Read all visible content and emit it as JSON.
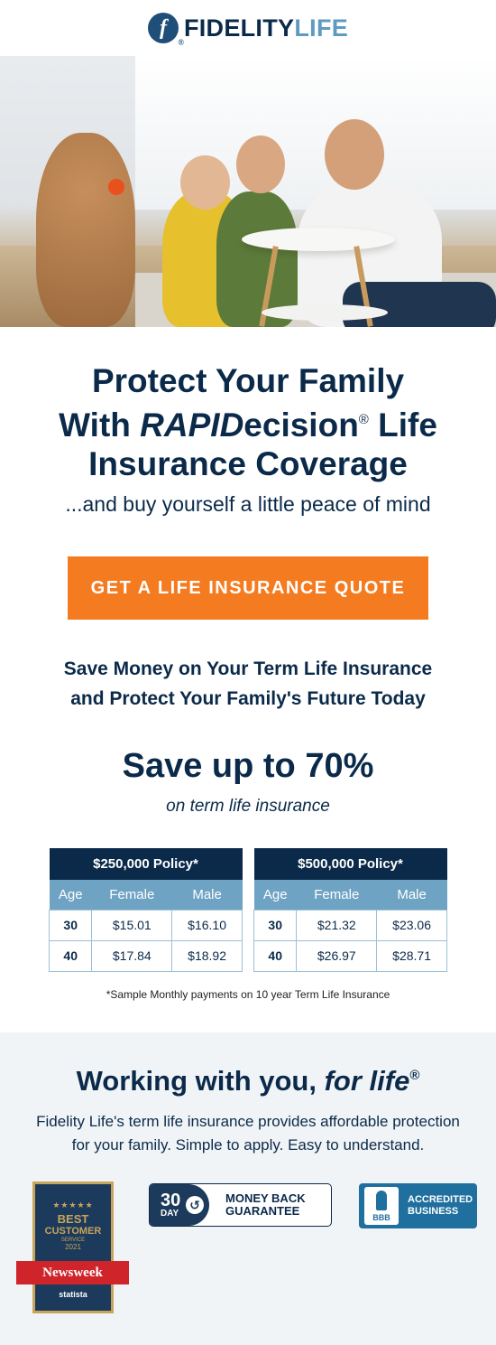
{
  "brand": {
    "name_part1": "FIDELITY",
    "name_part2": "LIFE",
    "logo_letter": "f",
    "logo_reg": "®"
  },
  "hero": {
    "icon": "family-photo"
  },
  "headline": {
    "line1": "Protect Your Family",
    "line2_prefix": "With ",
    "line2_em": "RAPID",
    "line2_rest": "ecision",
    "line2_reg": "®",
    "line2_suffix": " Life",
    "line3": "Insurance Coverage"
  },
  "tagline": "...and buy yourself a little peace of mind",
  "cta": {
    "label": "GET A LIFE INSURANCE QUOTE",
    "color": "#f47b20"
  },
  "save": {
    "sub_line1": "Save Money on Your Term Life Insurance",
    "sub_line2": "and Protect Your Family's Future Today",
    "big": "Save up to 70%",
    "note": "on term life insurance"
  },
  "policies": [
    {
      "title": "$250,000 Policy*",
      "headers": [
        "Age",
        "Female",
        "Male"
      ],
      "rows": [
        [
          "30",
          "$15.01",
          "$16.10"
        ],
        [
          "40",
          "$17.84",
          "$18.92"
        ]
      ]
    },
    {
      "title": "$500,000 Policy*",
      "headers": [
        "Age",
        "Female",
        "Male"
      ],
      "rows": [
        [
          "30",
          "$21.32",
          "$23.06"
        ],
        [
          "40",
          "$26.97",
          "$28.71"
        ]
      ]
    }
  ],
  "footnote": "*Sample Monthly payments on 10 year Term Life Insurance",
  "working": {
    "title_prefix": "Working with you, ",
    "title_em": "for life",
    "title_reg": "®",
    "desc_line1": "Fidelity Life's term life insurance provides affordable protection",
    "desc_line2": "for your family. Simple to apply. Easy to understand."
  },
  "badges": {
    "newsweek": {
      "stars": "★★★★★",
      "best": "BEST",
      "customer": "CUSTOMER",
      "service": "SERVICE",
      "year": "2021",
      "ribbon": "Newsweek",
      "statista": "statista"
    },
    "money_back": {
      "days": "30",
      "day_label": "DAY",
      "line1": "MONEY BACK",
      "line2": "GUARANTEE",
      "icon": "refresh-icon"
    },
    "bbb": {
      "mark": "BBB",
      "line1": "ACCREDITED",
      "line2": "BUSINESS"
    }
  },
  "colors": {
    "navy": "#0b2a4a",
    "accent": "#f47b20",
    "table_header": "#6fa3c4",
    "light_blue": "#5f9bbf"
  }
}
